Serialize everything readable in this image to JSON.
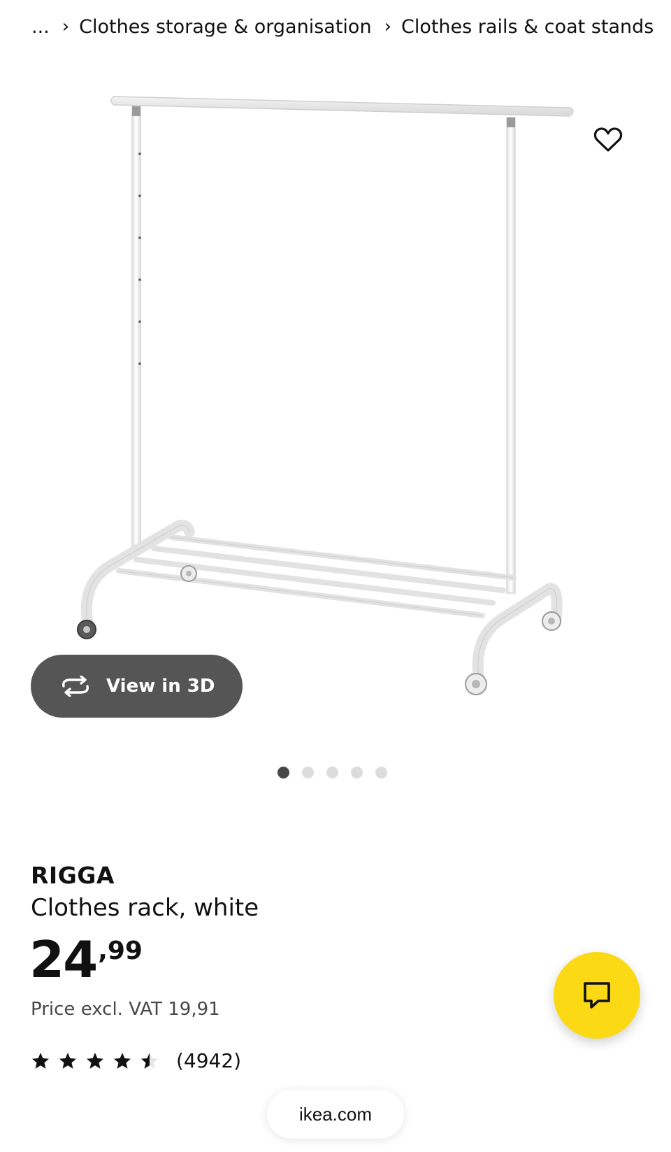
{
  "breadcrumb": {
    "ellipsis": "...",
    "items": [
      {
        "label": "Clothes storage & organisation"
      },
      {
        "label": "Clothes rails & coat stands"
      }
    ],
    "separator": "›"
  },
  "gallery": {
    "view3d_label": "View in 3D",
    "image_count": 5,
    "active_index": 0
  },
  "product": {
    "name": "RIGGA",
    "description": "Clothes rack, white",
    "price_integer": "24",
    "price_decimal": ",99",
    "vat_text": "Price excl. VAT 19,91",
    "rating": 4.5,
    "rating_max": 5,
    "review_count": "(4942)"
  },
  "browser": {
    "url": "ikea.com"
  },
  "icons": {
    "favorite": "heart-icon",
    "view3d": "rotate-3d-icon",
    "chat": "chat-bubble-icon",
    "star": "star-icon"
  },
  "colors": {
    "chat_fab": "#fbd914",
    "view3d_pill": "#555555",
    "dot_active": "#484848",
    "dot_inactive": "#dcdcdc"
  }
}
